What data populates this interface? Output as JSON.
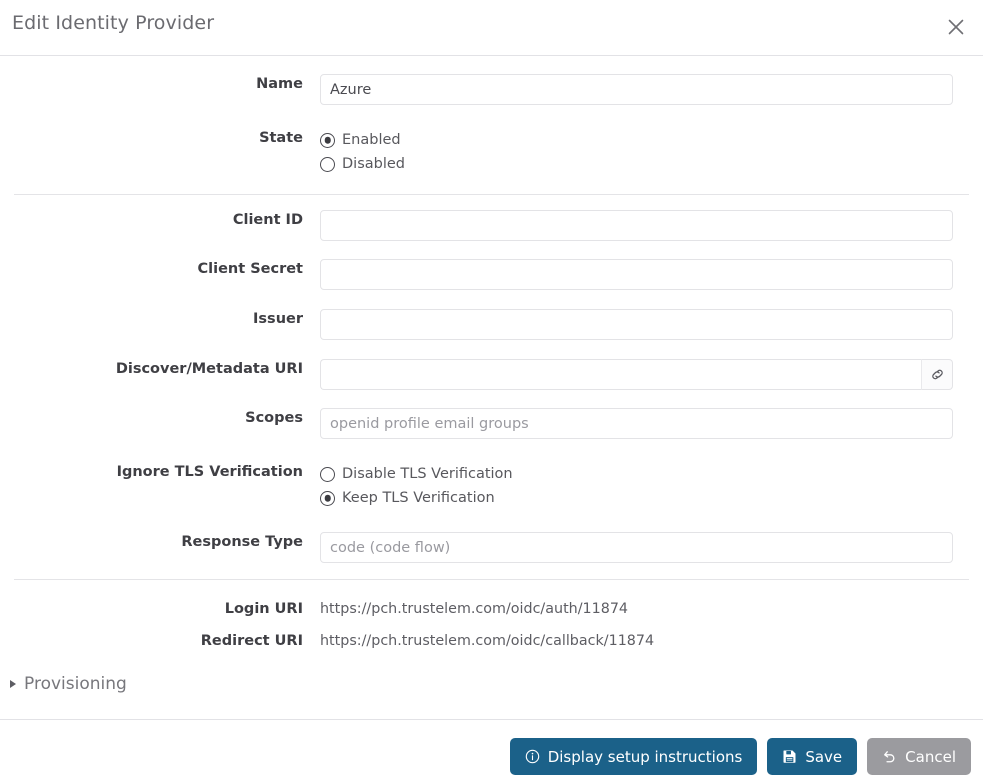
{
  "dialog": {
    "title": "Edit Identity Provider",
    "close_icon": "close-icon"
  },
  "form": {
    "name": {
      "label": "Name",
      "value": "Azure",
      "placeholder": ""
    },
    "state": {
      "label": "State",
      "options": [
        {
          "label": "Enabled",
          "selected": true
        },
        {
          "label": "Disabled",
          "selected": false
        }
      ]
    },
    "client_id": {
      "label": "Client ID",
      "value": "",
      "placeholder": ""
    },
    "client_secret": {
      "label": "Client Secret",
      "value": "",
      "placeholder": ""
    },
    "issuer": {
      "label": "Issuer",
      "value": "",
      "placeholder": ""
    },
    "discover_uri": {
      "label": "Discover/Metadata URI",
      "value": "",
      "placeholder": "",
      "addon_icon": "link-icon"
    },
    "scopes": {
      "label": "Scopes",
      "value": "",
      "placeholder": "openid profile email groups"
    },
    "ignore_tls": {
      "label": "Ignore TLS Verification",
      "options": [
        {
          "label": "Disable TLS Verification",
          "selected": false
        },
        {
          "label": "Keep TLS Verification",
          "selected": true
        }
      ]
    },
    "response_type": {
      "label": "Response Type",
      "value": "",
      "placeholder": "code (code flow)"
    },
    "login_uri": {
      "label": "Login URI",
      "value": "https://pch.trustelem.com/oidc/auth/11874"
    },
    "redirect_uri": {
      "label": "Redirect URI",
      "value": "https://pch.trustelem.com/oidc/callback/11874"
    },
    "provisioning": {
      "label": "Provisioning",
      "expanded": false,
      "toggle_icon": "triangle-right-icon"
    }
  },
  "footer": {
    "display_instructions": {
      "label": "Display setup instructions",
      "icon": "info-circle-icon"
    },
    "save": {
      "label": "Save",
      "icon": "floppy-disk-icon"
    },
    "cancel": {
      "label": "Cancel",
      "icon": "undo-arrow-icon"
    }
  },
  "colors": {
    "primary": "#1b6189",
    "muted": "#9b9b9f",
    "label_text": "#3f3f44",
    "value_text": "#58585d",
    "border": "#e3e3e6",
    "divider": "#e4e4e7"
  }
}
